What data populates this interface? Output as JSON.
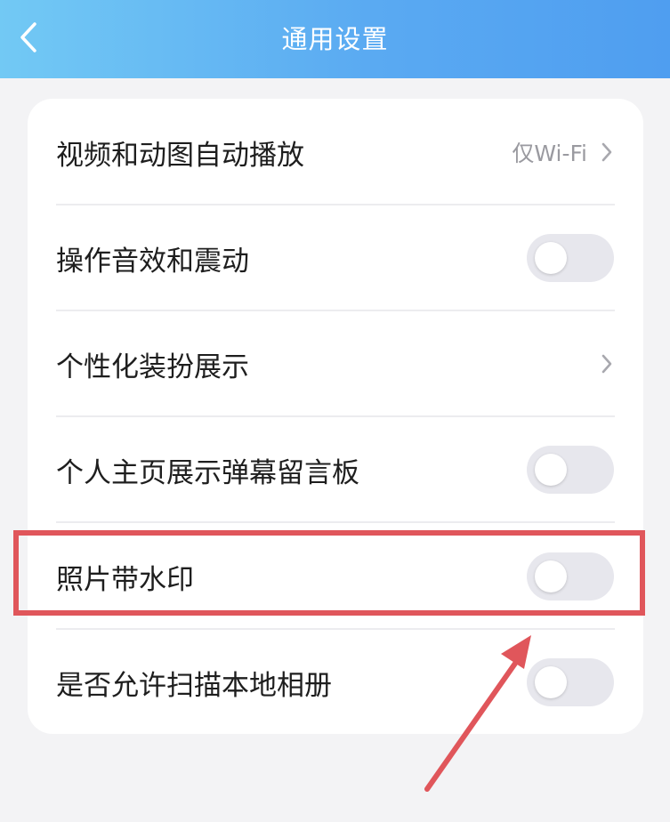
{
  "header": {
    "title": "通用设置",
    "back_icon": "chevron-left-icon"
  },
  "settings": [
    {
      "label": "视频和动图自动播放",
      "value": "仅Wi-Fi",
      "control": "chevron"
    },
    {
      "label": "操作音效和震动",
      "control": "toggle",
      "on": false
    },
    {
      "label": "个性化装扮展示",
      "control": "chevron"
    },
    {
      "label": "个人主页展示弹幕留言板",
      "control": "toggle",
      "on": false
    },
    {
      "label": "照片带水印",
      "control": "toggle",
      "on": false,
      "highlighted": true
    },
    {
      "label": "是否允许扫描本地相册",
      "control": "toggle",
      "on": false
    }
  ],
  "colors": {
    "header_start": "#72c9f4",
    "header_end": "#4f9ef0",
    "annotation": "#e0565b",
    "toggle_off": "#e7e7ed"
  }
}
